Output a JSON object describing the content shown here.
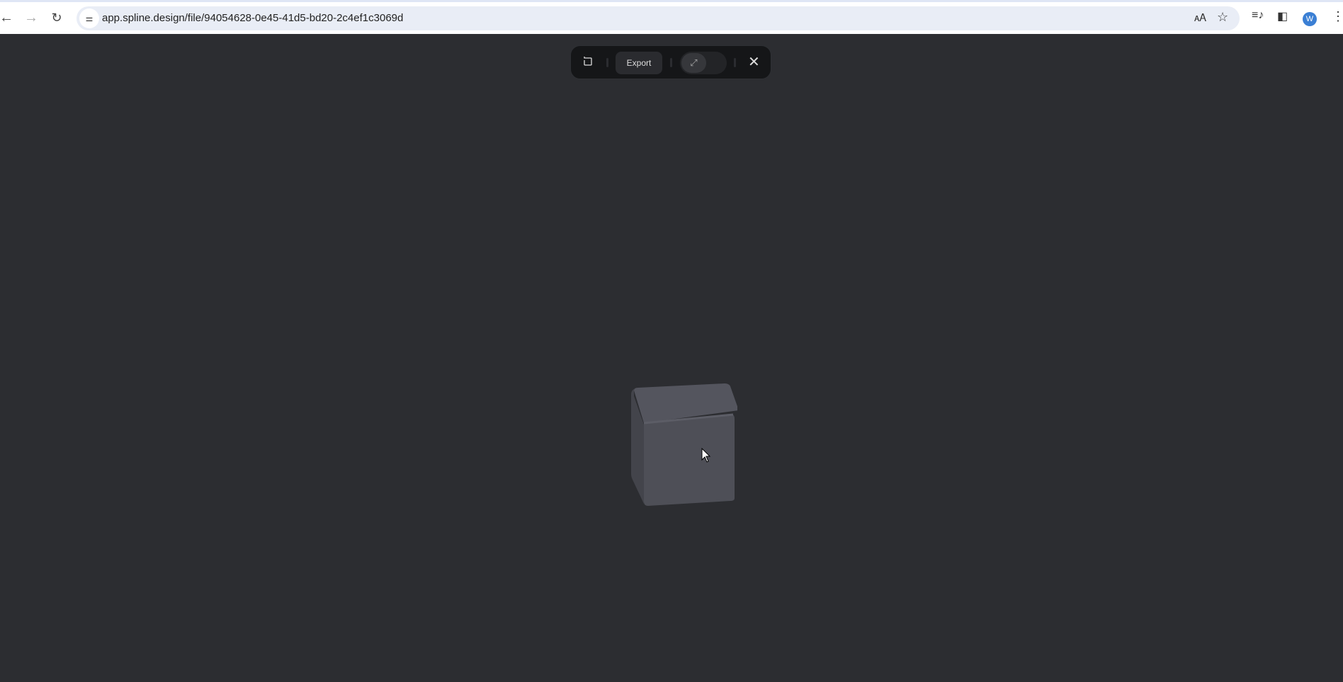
{
  "browser": {
    "url": "app.spline.design/file/94054628-0e45-41d5-bd20-2c4ef1c3069d",
    "avatar_letter": "W"
  },
  "toolbar": {
    "export_label": "Export"
  },
  "colors": {
    "canvas": "#2c2d31",
    "toolbar": "#151618",
    "cube": "#4e4f57",
    "avatar": "#3b7fd4"
  }
}
